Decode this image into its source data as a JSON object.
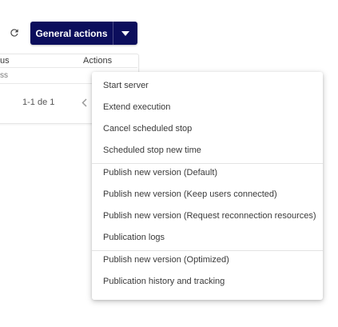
{
  "toolbar": {
    "refresh_icon": "refresh-icon",
    "general_actions_label": "General actions",
    "dropdown_icon": "caret-down-icon",
    "button_color": "#0c0e5c"
  },
  "table": {
    "headers": [
      "us",
      "Actions"
    ],
    "row_status_fragment": "ss",
    "pagination": "1-1 de 1",
    "prev_icon": "chevron-left-icon"
  },
  "menu": {
    "items": [
      "Start server",
      "Extend execution",
      "Cancel scheduled stop",
      "Scheduled stop new time",
      "Publish new version (Default)",
      "Publish new version (Keep users connected)",
      "Publish new version (Request reconnection resources)",
      "Publication logs",
      "Publish new version (Optimized)",
      "Publication history and tracking"
    ]
  }
}
